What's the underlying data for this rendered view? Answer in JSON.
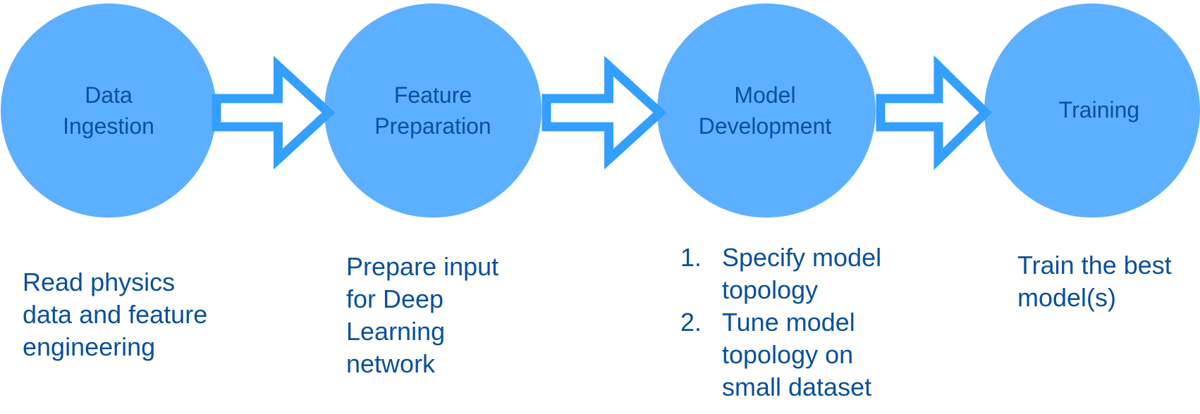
{
  "colors": {
    "circle": "#5cb0ff",
    "arrow": "#339ffe",
    "text": "#0a509c"
  },
  "stages": [
    {
      "title_lines": [
        "Data",
        "Ingestion"
      ],
      "description_lines": [
        "Read physics",
        "data and feature",
        "engineering"
      ]
    },
    {
      "title_lines": [
        "Feature",
        "Preparation"
      ],
      "description_lines": [
        "Prepare input",
        "for Deep",
        "Learning",
        "network"
      ]
    },
    {
      "title_lines": [
        "Model",
        "Development"
      ],
      "list": [
        {
          "num": "1.",
          "lines": [
            "Specify model",
            "topology"
          ]
        },
        {
          "num": "2.",
          "lines": [
            "Tune model",
            "topology on",
            "small dataset"
          ]
        }
      ]
    },
    {
      "title_lines": [
        "Training"
      ],
      "description_lines": [
        "Train the best",
        "model(s)"
      ]
    }
  ],
  "arrow_icon": "hollow-right-arrow"
}
